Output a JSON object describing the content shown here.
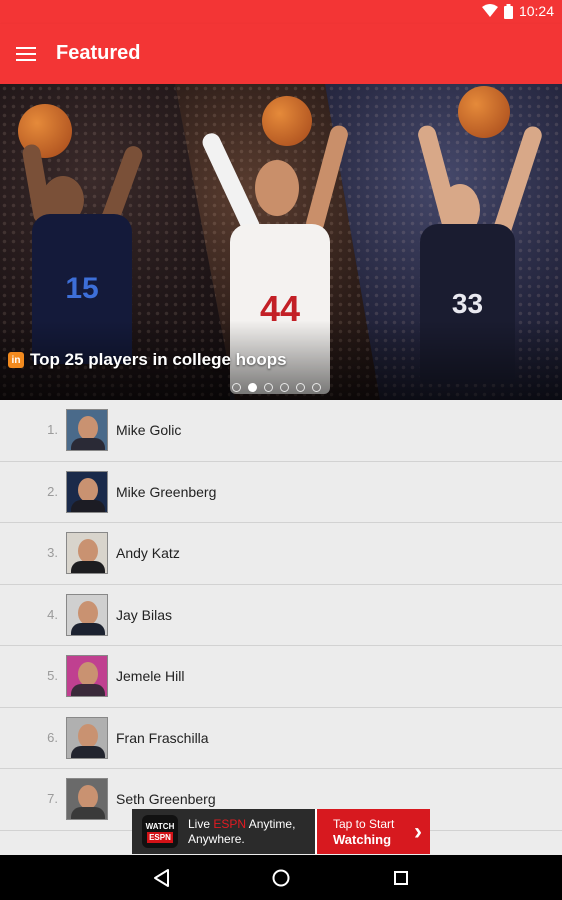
{
  "status_bar": {
    "time": "10:24"
  },
  "app_bar": {
    "title": "Featured"
  },
  "hero": {
    "badge": "in",
    "title": "Top 25 players in college hoops",
    "jersey_numbers": [
      "15",
      "44",
      "33"
    ],
    "page_count": 6,
    "active_page": 2
  },
  "list": [
    {
      "rank": "1.",
      "name": "Mike Golic"
    },
    {
      "rank": "2.",
      "name": "Mike Greenberg"
    },
    {
      "rank": "3.",
      "name": "Andy Katz"
    },
    {
      "rank": "4.",
      "name": "Jay Bilas"
    },
    {
      "rank": "5.",
      "name": "Jemele Hill"
    },
    {
      "rank": "6.",
      "name": "Fran Fraschilla"
    },
    {
      "rank": "7.",
      "name": "Seth Greenberg"
    }
  ],
  "ad": {
    "logo_top": "WATCH",
    "logo_bottom": "ESPN",
    "line1_pre": "Live ",
    "line1_brand": "ESPN",
    "line1_post": " Anytime,",
    "line2": "Anywhere.",
    "cta_line1": "Tap to Start",
    "cta_line2": "Watching"
  },
  "colors": {
    "accent": "#f33535",
    "ad_red": "#d7191f"
  }
}
